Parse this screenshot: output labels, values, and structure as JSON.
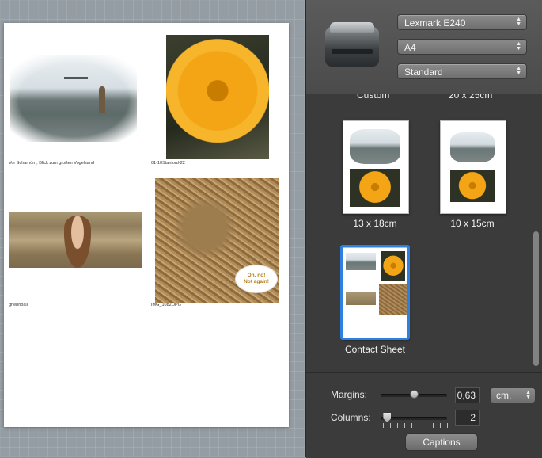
{
  "preview": {
    "captions": {
      "beach": "Vor Scharhörn, Blick zum großen Vogelsand",
      "flower": "01-10Stanford-22",
      "woman": "gherinbali",
      "monkeys": "IMG_1082.JPG"
    },
    "speech_bubble": "Oh, no!\nNot again!"
  },
  "printer_settings": {
    "printer": "Lexmark E240",
    "paper": "A4",
    "quality": "Standard"
  },
  "layouts": {
    "cut_labels": [
      "Custom",
      "20 x 25cm"
    ],
    "items": [
      {
        "label": "13 x 18cm",
        "selected": false
      },
      {
        "label": "10 x 15cm",
        "selected": false
      },
      {
        "label": "Contact Sheet",
        "selected": true
      }
    ]
  },
  "controls": {
    "margins_label": "Margins:",
    "margins_value": "0,63",
    "margins_fraction": 0.5,
    "unit": "cm.",
    "columns_label": "Columns:",
    "columns_value": "2",
    "columns_fraction": 0.1,
    "captions_button": "Captions"
  },
  "colors": {
    "selection": "#2d7fe0",
    "panel_bg": "#3b3b3b",
    "preview_bg": "#959da4"
  }
}
